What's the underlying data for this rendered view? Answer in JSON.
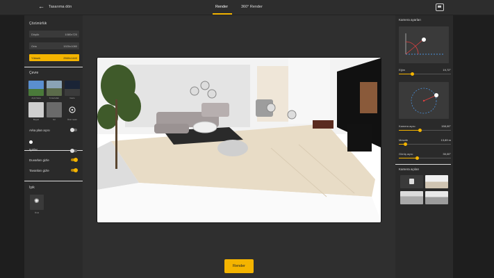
{
  "topbar": {
    "back_label": "Tasarıma dön",
    "tabs": [
      {
        "label": "Render",
        "active": true
      },
      {
        "label": "360° Render",
        "active": false
      }
    ]
  },
  "left": {
    "resolution_title": "Çözünürlük",
    "resolutions": [
      {
        "name": "Düşük",
        "value": "1080x720",
        "selected": false
      },
      {
        "name": "Orta",
        "value": "1920x1080",
        "selected": false
      },
      {
        "name": "Yüksek",
        "value": "2560x1440",
        "selected": true
      }
    ],
    "environment_title": "Çevre",
    "environments": [
      {
        "label": "Açık hava"
      },
      {
        "label": "Kırsal alan"
      },
      {
        "label": "Gece"
      },
      {
        "label": "Beyaz"
      },
      {
        "label": "Gri"
      },
      {
        "label": "Özel resim"
      }
    ],
    "background_angle": "Arka plan açısı",
    "toggles": [
      {
        "label": "Işıklar",
        "on": false
      },
      {
        "label": "Duvarları gizle",
        "on": true
      },
      {
        "label": "Tavanları gizle",
        "on": true
      }
    ],
    "light_title": "Işık",
    "light_option": "Özel"
  },
  "center": {
    "render_button": "Render"
  },
  "right": {
    "camera_settings_title": "Kamera ayarları",
    "sliders": [
      {
        "label": "Eğim",
        "value": "19,72°",
        "fraction": 0.25
      },
      {
        "label": "Kamera açısı",
        "value": "158,00°",
        "fraction": 0.4
      },
      {
        "label": "Mesafe",
        "value": "13,89 m",
        "fraction": 0.12
      },
      {
        "label": "Görüş açısı",
        "value": "35,00°",
        "fraction": 0.35
      }
    ],
    "camera_angles_title": "Kamera açıları"
  },
  "colors": {
    "accent": "#f4b400",
    "panel": "#2a2a2a",
    "background": "#2f2f2f"
  }
}
